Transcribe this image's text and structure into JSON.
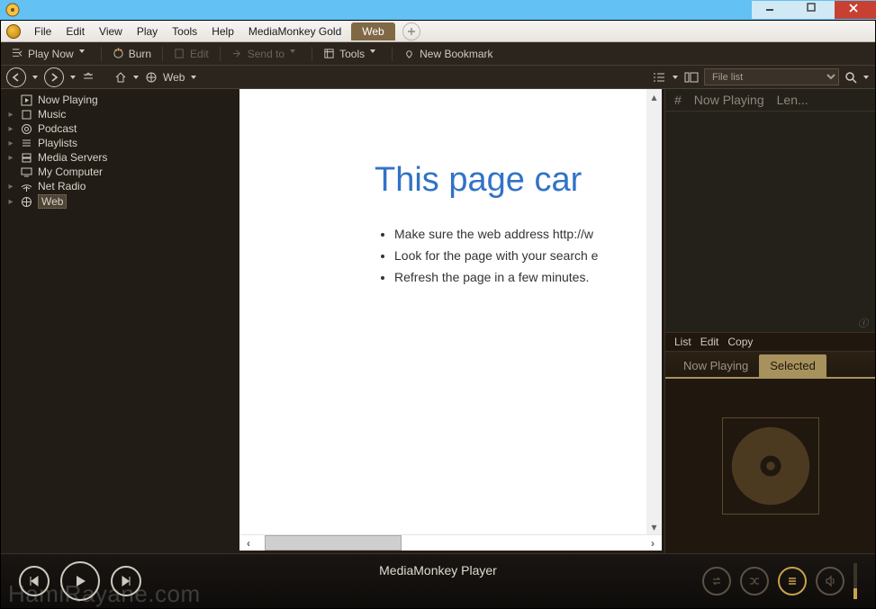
{
  "menubar": {
    "items": [
      "File",
      "Edit",
      "View",
      "Play",
      "Tools",
      "Help",
      "MediaMonkey Gold"
    ],
    "active_tab": "Web"
  },
  "toolbar": {
    "play_now": "Play Now",
    "burn": "Burn",
    "edit": "Edit",
    "send_to": "Send to",
    "tools": "Tools",
    "new_bookmark": "New Bookmark"
  },
  "navbar": {
    "breadcrumb": "Web",
    "combo_value": "File list"
  },
  "tree": [
    {
      "label": "Now Playing",
      "icon": "play",
      "expandable": false
    },
    {
      "label": "Music",
      "icon": "music",
      "expandable": true
    },
    {
      "label": "Podcast",
      "icon": "podcast",
      "expandable": true
    },
    {
      "label": "Playlists",
      "icon": "playlists",
      "expandable": true
    },
    {
      "label": "Media Servers",
      "icon": "servers",
      "expandable": true
    },
    {
      "label": "My Computer",
      "icon": "computer",
      "expandable": false
    },
    {
      "label": "Net Radio",
      "icon": "radio",
      "expandable": true
    },
    {
      "label": "Web",
      "icon": "web",
      "expandable": true,
      "selected": true
    }
  ],
  "browser": {
    "heading": "This page car",
    "bullets": [
      "Make sure the web address http://w",
      "Look for the page with your search e",
      "Refresh the page in a few minutes."
    ]
  },
  "tracklist": {
    "cols": [
      "#",
      "Now Playing",
      "Len..."
    ]
  },
  "artpanel": {
    "menu": [
      "List",
      "Edit",
      "Copy"
    ],
    "tabs": [
      "Now Playing",
      "Selected"
    ],
    "active_tab": "Selected"
  },
  "player": {
    "title": "MediaMonkey Player"
  },
  "watermark": "HamiRayane.com"
}
